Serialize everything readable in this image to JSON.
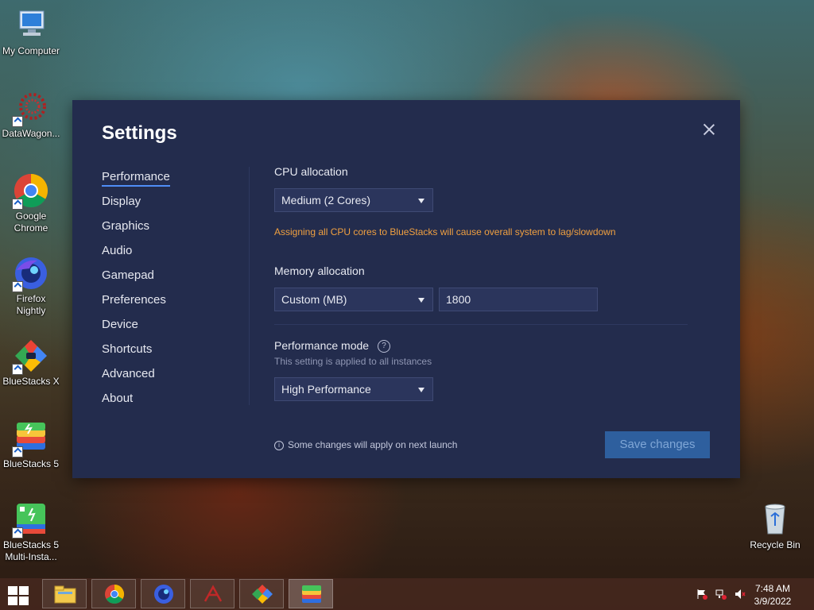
{
  "desktop": {
    "icons": [
      {
        "label": "My Computer"
      },
      {
        "label": "DataWagon..."
      },
      {
        "label": "Google Chrome"
      },
      {
        "label": "Firefox Nightly"
      },
      {
        "label": "BlueStacks X"
      },
      {
        "label": "BlueStacks 5"
      },
      {
        "label": "BlueStacks 5 Multi-Insta..."
      },
      {
        "label": "Recycle Bin"
      }
    ]
  },
  "settings": {
    "title": "Settings",
    "nav": [
      "Performance",
      "Display",
      "Graphics",
      "Audio",
      "Gamepad",
      "Preferences",
      "Device",
      "Shortcuts",
      "Advanced",
      "About"
    ],
    "active_nav": "Performance",
    "cpu": {
      "label": "CPU allocation",
      "value": "Medium (2 Cores)",
      "warning": "Assigning all CPU cores to BlueStacks will cause overall system to lag/slowdown"
    },
    "memory": {
      "label": "Memory allocation",
      "mode": "Custom (MB)",
      "value": "1800"
    },
    "performance_mode": {
      "label": "Performance mode",
      "help": "?",
      "subtitle": "This setting is applied to all instances",
      "value": "High Performance"
    },
    "note": "Some changes will apply on next launch",
    "save_label": "Save changes",
    "colors": {
      "bg": "#232c4d",
      "accent": "#4f8ef7",
      "warning": "#f0a040",
      "save_bg": "#2e5f9e"
    }
  },
  "taskbar": {
    "clock": {
      "time": "7:48 AM",
      "date": "3/9/2022"
    }
  }
}
